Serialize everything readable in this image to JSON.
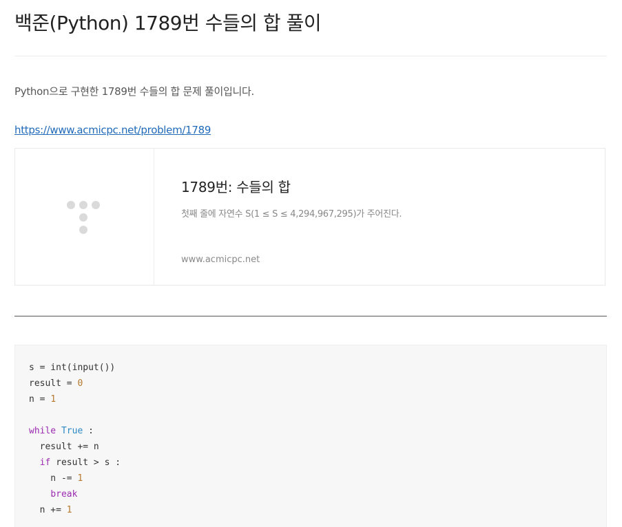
{
  "post": {
    "title": "백준(Python) 1789번 수들의 합 풀이",
    "intro": "Python으로 구현한 1789번 수들의 합 문제 풀이입니다.",
    "link": "https://www.acmicpc.net/problem/1789"
  },
  "og_card": {
    "title": "1789번: 수들의 합",
    "description": "첫째 줄에 자연수 S(1 ≤ S ≤ 4,294,967,295)가 주어진다.",
    "domain": "www.acmicpc.net",
    "logo_icon": "startlink-dots-logo-icon"
  },
  "code": {
    "l1": {
      "a": "s = int(input())"
    },
    "l2": {
      "a": "result = ",
      "num": "0"
    },
    "l3": {
      "a": "n = ",
      "num": "1"
    },
    "l5": {
      "kw": "while",
      "sp": " ",
      "lit": "True",
      "b": " :"
    },
    "l6": {
      "a": "  result += n"
    },
    "l7": {
      "indent": "  ",
      "kw": "if",
      "b": " result > s :"
    },
    "l8": {
      "a": "    n -= ",
      "num": "1"
    },
    "l9": {
      "indent": "    ",
      "kw": "break"
    },
    "l10": {
      "a": "  n += ",
      "num": "1"
    }
  },
  "colors": {
    "link": "#1f6ab9",
    "code_bg": "#f7f7f7",
    "keyword": "#9b2bb0",
    "number": "#b5782c",
    "literal": "#2a89c4"
  }
}
